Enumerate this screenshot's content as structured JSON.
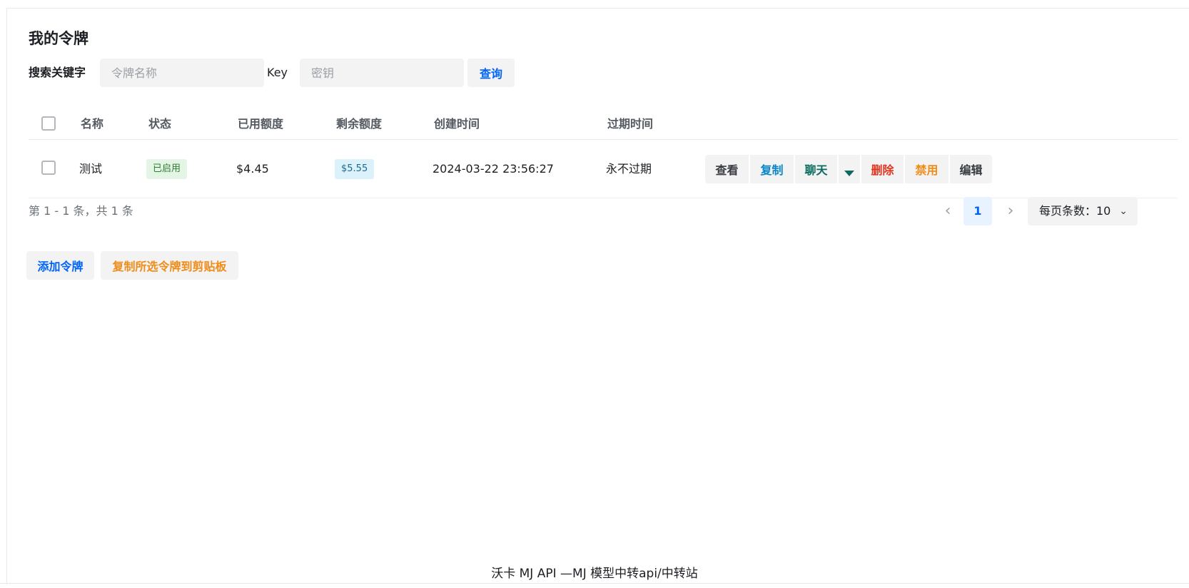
{
  "page": {
    "title": "我的令牌"
  },
  "search": {
    "keyword_label": "搜索关键字",
    "name_placeholder": "令牌名称",
    "key_label": "Key",
    "key_placeholder": "密钥",
    "query_button": "查询"
  },
  "table": {
    "columns": [
      "名称",
      "状态",
      "已用额度",
      "剩余额度",
      "创建时间",
      "过期时间"
    ],
    "rows": [
      {
        "name": "测试",
        "status": "已启用",
        "used": "$4.45",
        "remaining": "$5.55",
        "created": "2024-03-22 23:56:27",
        "expires": "永不过期",
        "actions": {
          "view": "查看",
          "copy": "复制",
          "chat": "聊天",
          "delete": "删除",
          "disable": "禁用",
          "edit": "编辑"
        }
      }
    ]
  },
  "pagination": {
    "info": "第 1 - 1 条，共 1 条",
    "current_page": "1",
    "page_size_label": "每页条数：10"
  },
  "buttons": {
    "add_token": "添加令牌",
    "copy_selected": "复制所选令牌到剪贴板"
  },
  "footer": {
    "text": "沃卡 MJ API —MJ 模型中转api/中转站"
  },
  "colors": {
    "primary": "#0064fa",
    "copy": "#0b86c8",
    "chat": "#0b6b5f",
    "delete": "#e0351f",
    "disable": "#f08c18",
    "status_enabled_bg": "#e4f5e6",
    "remaining_bg": "#dcf2fb"
  },
  "icons": {
    "prev": "chevron-left-icon",
    "next": "chevron-right-icon",
    "page_size_dropdown": "chevron-down-icon",
    "actions_dropdown": "caret-down-icon"
  }
}
